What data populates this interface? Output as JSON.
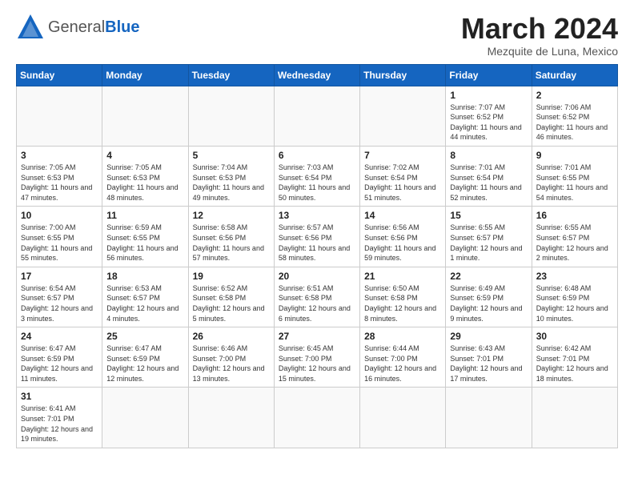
{
  "header": {
    "logo_general": "General",
    "logo_blue": "Blue",
    "month_title": "March 2024",
    "location": "Mezquite de Luna, Mexico"
  },
  "weekdays": [
    "Sunday",
    "Monday",
    "Tuesday",
    "Wednesday",
    "Thursday",
    "Friday",
    "Saturday"
  ],
  "weeks": [
    [
      {
        "day": "",
        "info": ""
      },
      {
        "day": "",
        "info": ""
      },
      {
        "day": "",
        "info": ""
      },
      {
        "day": "",
        "info": ""
      },
      {
        "day": "",
        "info": ""
      },
      {
        "day": "1",
        "info": "Sunrise: 7:07 AM\nSunset: 6:52 PM\nDaylight: 11 hours and 44 minutes."
      },
      {
        "day": "2",
        "info": "Sunrise: 7:06 AM\nSunset: 6:52 PM\nDaylight: 11 hours and 46 minutes."
      }
    ],
    [
      {
        "day": "3",
        "info": "Sunrise: 7:05 AM\nSunset: 6:53 PM\nDaylight: 11 hours and 47 minutes."
      },
      {
        "day": "4",
        "info": "Sunrise: 7:05 AM\nSunset: 6:53 PM\nDaylight: 11 hours and 48 minutes."
      },
      {
        "day": "5",
        "info": "Sunrise: 7:04 AM\nSunset: 6:53 PM\nDaylight: 11 hours and 49 minutes."
      },
      {
        "day": "6",
        "info": "Sunrise: 7:03 AM\nSunset: 6:54 PM\nDaylight: 11 hours and 50 minutes."
      },
      {
        "day": "7",
        "info": "Sunrise: 7:02 AM\nSunset: 6:54 PM\nDaylight: 11 hours and 51 minutes."
      },
      {
        "day": "8",
        "info": "Sunrise: 7:01 AM\nSunset: 6:54 PM\nDaylight: 11 hours and 52 minutes."
      },
      {
        "day": "9",
        "info": "Sunrise: 7:01 AM\nSunset: 6:55 PM\nDaylight: 11 hours and 54 minutes."
      }
    ],
    [
      {
        "day": "10",
        "info": "Sunrise: 7:00 AM\nSunset: 6:55 PM\nDaylight: 11 hours and 55 minutes."
      },
      {
        "day": "11",
        "info": "Sunrise: 6:59 AM\nSunset: 6:55 PM\nDaylight: 11 hours and 56 minutes."
      },
      {
        "day": "12",
        "info": "Sunrise: 6:58 AM\nSunset: 6:56 PM\nDaylight: 11 hours and 57 minutes."
      },
      {
        "day": "13",
        "info": "Sunrise: 6:57 AM\nSunset: 6:56 PM\nDaylight: 11 hours and 58 minutes."
      },
      {
        "day": "14",
        "info": "Sunrise: 6:56 AM\nSunset: 6:56 PM\nDaylight: 11 hours and 59 minutes."
      },
      {
        "day": "15",
        "info": "Sunrise: 6:55 AM\nSunset: 6:57 PM\nDaylight: 12 hours and 1 minute."
      },
      {
        "day": "16",
        "info": "Sunrise: 6:55 AM\nSunset: 6:57 PM\nDaylight: 12 hours and 2 minutes."
      }
    ],
    [
      {
        "day": "17",
        "info": "Sunrise: 6:54 AM\nSunset: 6:57 PM\nDaylight: 12 hours and 3 minutes."
      },
      {
        "day": "18",
        "info": "Sunrise: 6:53 AM\nSunset: 6:57 PM\nDaylight: 12 hours and 4 minutes."
      },
      {
        "day": "19",
        "info": "Sunrise: 6:52 AM\nSunset: 6:58 PM\nDaylight: 12 hours and 5 minutes."
      },
      {
        "day": "20",
        "info": "Sunrise: 6:51 AM\nSunset: 6:58 PM\nDaylight: 12 hours and 6 minutes."
      },
      {
        "day": "21",
        "info": "Sunrise: 6:50 AM\nSunset: 6:58 PM\nDaylight: 12 hours and 8 minutes."
      },
      {
        "day": "22",
        "info": "Sunrise: 6:49 AM\nSunset: 6:59 PM\nDaylight: 12 hours and 9 minutes."
      },
      {
        "day": "23",
        "info": "Sunrise: 6:48 AM\nSunset: 6:59 PM\nDaylight: 12 hours and 10 minutes."
      }
    ],
    [
      {
        "day": "24",
        "info": "Sunrise: 6:47 AM\nSunset: 6:59 PM\nDaylight: 12 hours and 11 minutes."
      },
      {
        "day": "25",
        "info": "Sunrise: 6:47 AM\nSunset: 6:59 PM\nDaylight: 12 hours and 12 minutes."
      },
      {
        "day": "26",
        "info": "Sunrise: 6:46 AM\nSunset: 7:00 PM\nDaylight: 12 hours and 13 minutes."
      },
      {
        "day": "27",
        "info": "Sunrise: 6:45 AM\nSunset: 7:00 PM\nDaylight: 12 hours and 15 minutes."
      },
      {
        "day": "28",
        "info": "Sunrise: 6:44 AM\nSunset: 7:00 PM\nDaylight: 12 hours and 16 minutes."
      },
      {
        "day": "29",
        "info": "Sunrise: 6:43 AM\nSunset: 7:01 PM\nDaylight: 12 hours and 17 minutes."
      },
      {
        "day": "30",
        "info": "Sunrise: 6:42 AM\nSunset: 7:01 PM\nDaylight: 12 hours and 18 minutes."
      }
    ],
    [
      {
        "day": "31",
        "info": "Sunrise: 6:41 AM\nSunset: 7:01 PM\nDaylight: 12 hours and 19 minutes."
      },
      {
        "day": "",
        "info": ""
      },
      {
        "day": "",
        "info": ""
      },
      {
        "day": "",
        "info": ""
      },
      {
        "day": "",
        "info": ""
      },
      {
        "day": "",
        "info": ""
      },
      {
        "day": "",
        "info": ""
      }
    ]
  ]
}
